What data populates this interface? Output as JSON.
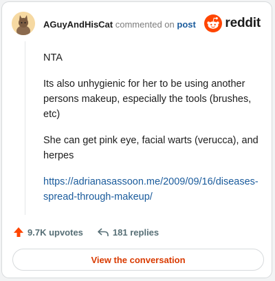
{
  "comment": {
    "username": "AGuyAndHisCat",
    "action_text": "commented on",
    "post_link_text": "post",
    "paragraphs": [
      "NTA",
      "Its also unhygienic for her to be using another persons makeup, especially the tools (brushes, etc)",
      "She can get pink eye, facial warts (verucca), and herpes"
    ],
    "link": "https://adrianasassoon.me/2009/09/16/diseases-spread-through-makeup/"
  },
  "brand": {
    "name": "reddit",
    "icon": "reddit-alien-logo",
    "color": "#ff4500"
  },
  "stats": {
    "upvotes": "9.7K upvotes",
    "replies": "181 replies"
  },
  "cta": {
    "label": "View the conversation"
  },
  "colors": {
    "accent": "#d93a00",
    "link": "#1a5b9c",
    "upvote": "#ff4500"
  }
}
